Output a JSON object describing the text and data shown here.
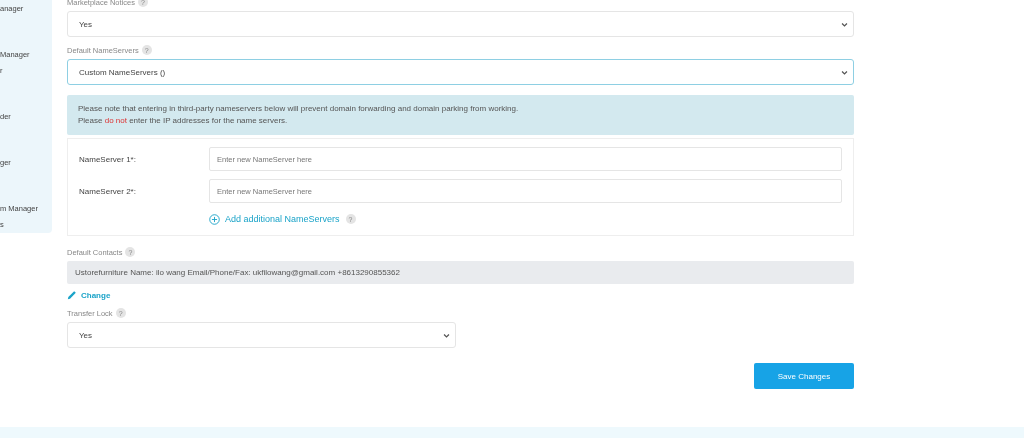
{
  "sidebar": {
    "groups": [
      [
        "anager"
      ],
      [
        "Manager",
        "r"
      ],
      [
        "der"
      ],
      [
        "ger"
      ],
      [
        "m Manager",
        "s"
      ]
    ]
  },
  "marketplace_notices": {
    "label": "Marketplace Notices",
    "help": "?",
    "value": "Yes",
    "focused": false
  },
  "default_nameservers": {
    "label": "Default NameServers",
    "help": "?",
    "value": "Custom NameServers ()",
    "focused": true
  },
  "notice": {
    "line_1": "Please note that entering in third-party nameservers below will prevent domain forwarding and domain parking from working.",
    "line_2": "Please **do not** enter the IP addresses for the name servers."
  },
  "nameservers": [
    {
      "label": "NameServer 1*:",
      "placeholder": "Enter new NameServer here"
    },
    {
      "label": "NameServer 2*:",
      "placeholder": "Enter new NameServer here"
    }
  ],
  "add_nameservers": {
    "label": "Add additional NameServers",
    "help": "?"
  },
  "default_contacts": {
    "label": "Default Contacts",
    "help": "?",
    "value": "Ustorefurniture Name: ilo wang Email/Phone/Fax: ukfilowang@gmail.com +8613290855362",
    "change": "Change"
  },
  "transfer_lock": {
    "label": "Transfer Lock",
    "help": "?",
    "value": "Yes",
    "focused": false
  },
  "save_button": "Save Changes"
}
